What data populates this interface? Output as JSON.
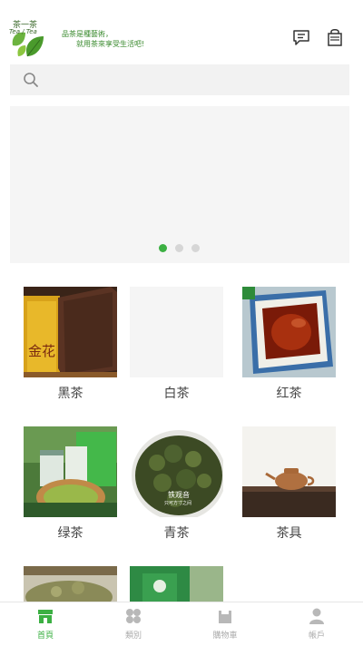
{
  "header": {
    "logo_title": "茶一茶",
    "logo_subtitle": "Tea / Tea",
    "slogan_line1": "品茶是種藝術，",
    "slogan_line2": "就用茶來享受生活吧!",
    "message_icon": "message-icon",
    "bag_icon": "shopping-bag-icon"
  },
  "search": {
    "placeholder": "",
    "icon": "search-icon"
  },
  "banner": {
    "slide_count": 3,
    "active_slide": 1
  },
  "categories": [
    {
      "label": "黑茶"
    },
    {
      "label": "白茶"
    },
    {
      "label": "红茶"
    },
    {
      "label": "绿茶"
    },
    {
      "label": "青茶"
    },
    {
      "label": "茶具"
    }
  ],
  "product_image_text": "铁观音",
  "product_image_subtext": "只可方寸之间",
  "tabbar": {
    "items": [
      {
        "label": "首頁",
        "icon": "home-icon",
        "active": true
      },
      {
        "label": "類別",
        "icon": "category-icon",
        "active": false
      },
      {
        "label": "購物車",
        "icon": "cart-icon",
        "active": false
      },
      {
        "label": "帳戶",
        "icon": "account-icon",
        "active": false
      }
    ]
  },
  "colors": {
    "accent": "#3cb043",
    "inactive": "#aaaaaa",
    "search_bg": "#f2f2f2"
  }
}
